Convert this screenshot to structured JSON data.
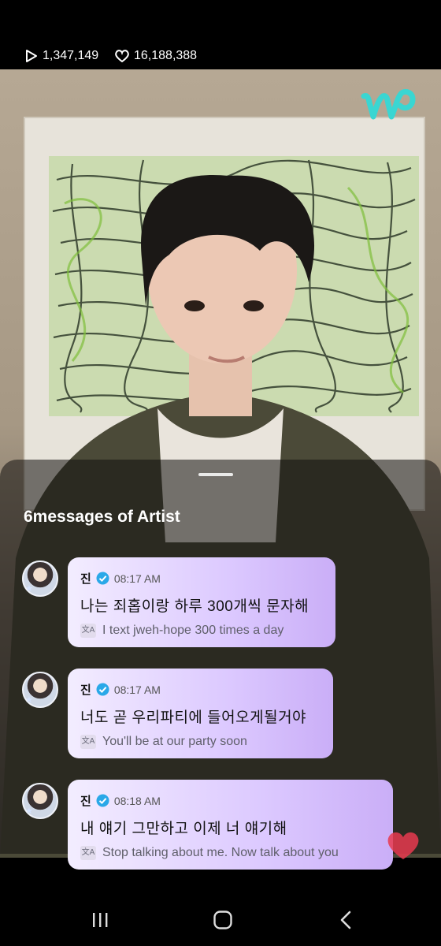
{
  "stats": {
    "views": "1,347,149",
    "likes": "16,188,388"
  },
  "logo": {
    "icon": "weverse-logo",
    "color": "#3ad6d2"
  },
  "sheet": {
    "title": "6messages of Artist"
  },
  "messages": [
    {
      "author": "진",
      "time": "08:17 AM",
      "text": "나는 죄홉이랑 하루 300개씩 문자해",
      "translation": "I text jweh-hope 300 times a day"
    },
    {
      "author": "진",
      "time": "08:17 AM",
      "text": "너도 곧 우리파티에 들어오게될거야",
      "translation": "You'll be at our party soon"
    },
    {
      "author": "진",
      "time": "08:18 AM",
      "text": "내 얘기 그만하고 이제 너 얘기해",
      "translation": "Stop talking about me. Now talk about you"
    }
  ],
  "icons": {
    "play": "play-icon",
    "heart": "heart-icon",
    "verified": "verified-badge-icon",
    "translate": "translate-icon",
    "nav_recent": "recent-apps-icon",
    "nav_home": "home-icon",
    "nav_back": "back-icon"
  },
  "colors": {
    "bubble_start": "#f3edff",
    "bubble_end": "#caaef7",
    "verified": "#2aa8e8",
    "heart_float": "#e8394f"
  }
}
